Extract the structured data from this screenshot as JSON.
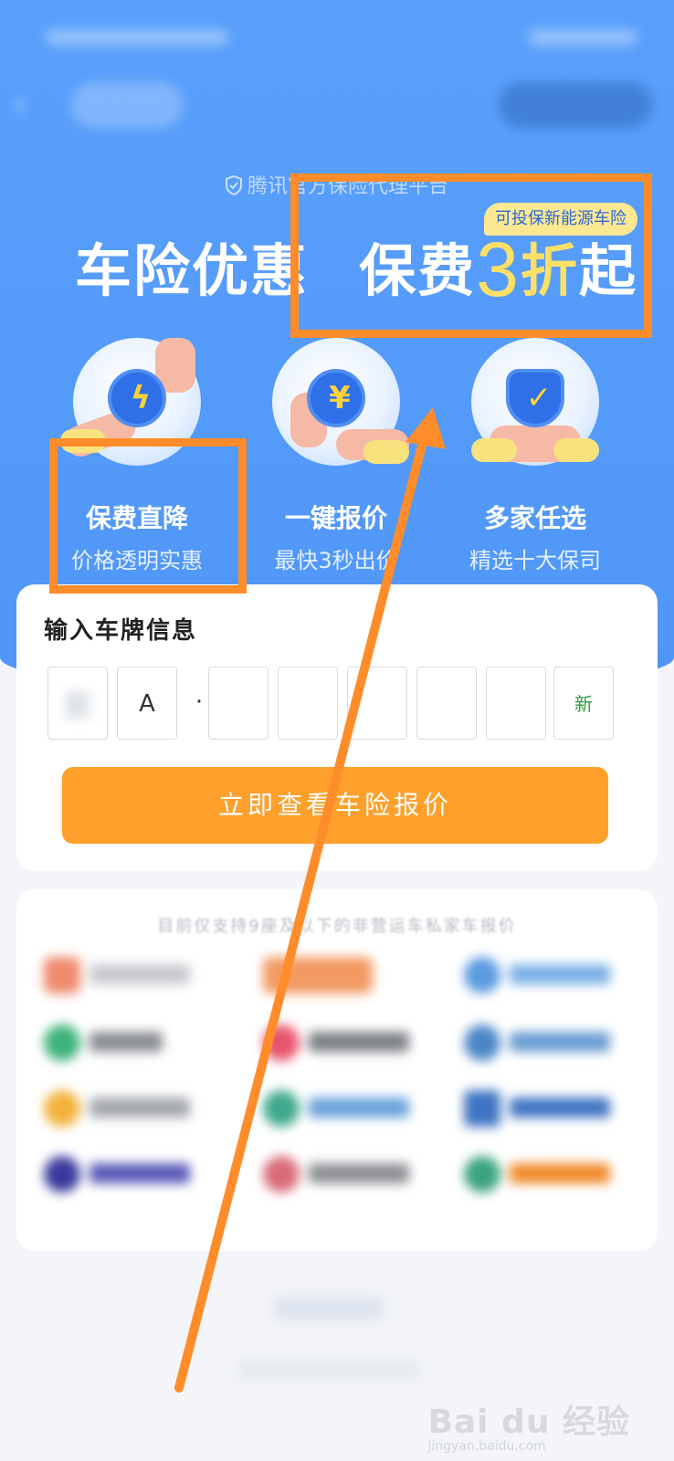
{
  "brand": {
    "subtitle": "腾讯官方保险代理平台"
  },
  "headline": {
    "part1": "车险优惠",
    "part2": "保费",
    "number": "3",
    "discount": "折",
    "suffix": "起",
    "tag": "可投保新能源车险"
  },
  "features": [
    {
      "title": "保费直降",
      "desc": "价格透明实惠",
      "icon": "lightning-icon",
      "glyph": "ϟ"
    },
    {
      "title": "一键报价",
      "desc": "最快3秒出价",
      "icon": "yen-stopwatch-icon",
      "glyph": "¥"
    },
    {
      "title": "多家任选",
      "desc": "精选十大保司",
      "icon": "shield-check-icon",
      "glyph": "✓"
    }
  ],
  "plate_card": {
    "title": "输入车牌信息",
    "city_letter": "A",
    "separator": "·",
    "new_energy": "新",
    "cta": "立即查看车险报价"
  },
  "partners": {
    "note": "目前仅支持9座及以下的非营运车私家车报价"
  },
  "watermark": {
    "main": "Bai du 经验",
    "sub": "jingyan.baidu.com"
  },
  "colors": {
    "hero": "#4f96f8",
    "accent": "#fea02b",
    "highlight": "#ff8c2a",
    "number": "#ffe066"
  }
}
